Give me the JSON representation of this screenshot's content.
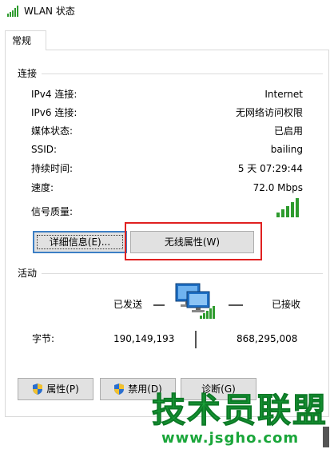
{
  "window": {
    "title": "WLAN 状态"
  },
  "tabs": [
    {
      "label": "常规"
    }
  ],
  "connection": {
    "group_title": "连接",
    "rows": [
      {
        "key": "IPv4 连接:",
        "value": "Internet"
      },
      {
        "key": "IPv6 连接:",
        "value": "无网络访问权限"
      },
      {
        "key": "媒体状态:",
        "value": "已启用"
      },
      {
        "key": "SSID:",
        "value": "bailing"
      },
      {
        "key": "持续时间:",
        "value": "5 天 07:29:44"
      },
      {
        "key": "速度:",
        "value": "72.0 Mbps"
      }
    ],
    "signal_label": "信号质量:",
    "signal_bars": 5,
    "signal_level": 1.0,
    "details_button": "详细信息(E)...",
    "wireless_props_button": "无线属性(W)"
  },
  "activity": {
    "group_title": "活动",
    "sent_label": "已发送",
    "received_label": "已接收",
    "bytes_label": "字节:",
    "bytes_sent": "190,149,193",
    "bytes_received": "868,295,008"
  },
  "footer_buttons": {
    "properties": "属性(P)",
    "disable": "禁用(D)",
    "diagnose": "诊断(G)"
  },
  "watermark": {
    "line1": "技术员联盟",
    "line2": "www.jsgho.com"
  },
  "colors": {
    "signal_green": "#2e9b2e",
    "highlight_red": "#e02020",
    "focus_blue": "#3c7fc5",
    "button_bg": "#e1e1e1",
    "watermark_green": "#1aa63a"
  }
}
